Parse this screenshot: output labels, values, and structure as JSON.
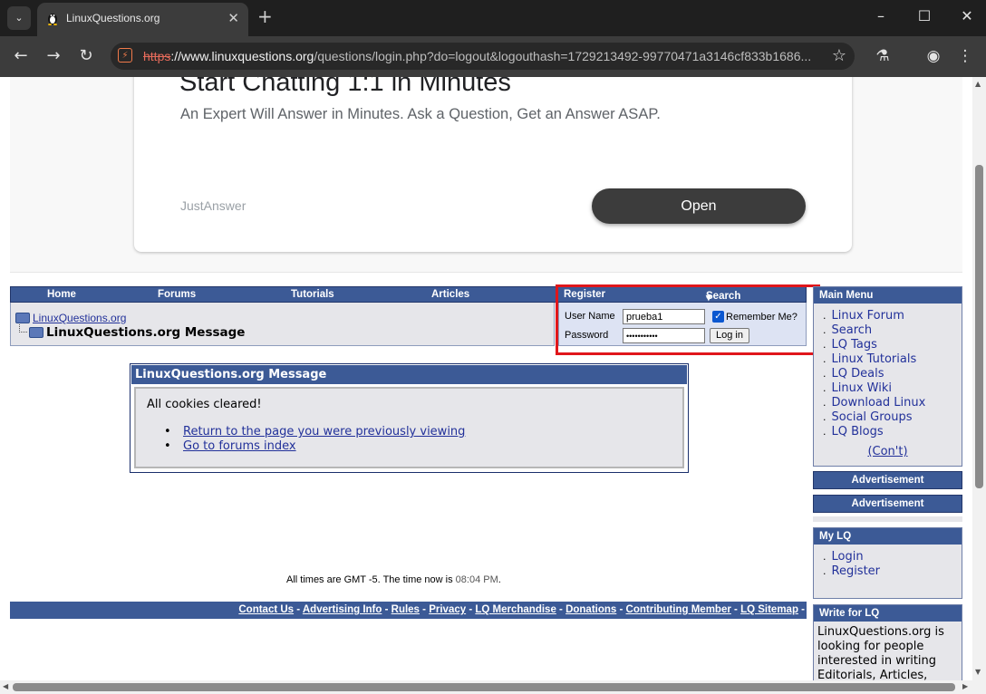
{
  "browser": {
    "tab_title": "LinuxQuestions.org",
    "tab_close": "✕",
    "new_tab": "+",
    "menu_icon": "chevron-down-icon",
    "url_scheme": "https",
    "url_host": "://www.linuxquestions.org",
    "url_path": "/questions/login.php?do=logout&logouthash=1729213492-99770471a3146cf833b1686...",
    "window_controls": [
      "–",
      "☐",
      "✕"
    ]
  },
  "ad": {
    "headline": "Start Chatting 1:1 in Minutes",
    "subline": "An Expert Will Answer in Minutes. Ask a Question, Get an Answer ASAP.",
    "brand": "JustAnswer",
    "open_label": "Open"
  },
  "nav": {
    "items": [
      "Home",
      "Forums",
      "Tutorials",
      "Articles"
    ],
    "register": "Register",
    "search": "Search"
  },
  "breadcrumb": {
    "root": "LinuxQuestions.org",
    "current": "LinuxQuestions.org Message"
  },
  "login": {
    "username_label": "User Name",
    "username_value": "prueba1",
    "remember_label": "Remember Me?",
    "remember_checked": true,
    "password_label": "Password",
    "password_value": "•••••••••••",
    "login_button": "Log in"
  },
  "message": {
    "header": "LinuxQuestions.org Message",
    "text": "All cookies cleared!",
    "links": [
      "Return to the page you were previously viewing",
      "Go to forums index"
    ]
  },
  "times": {
    "prefix": "All times are GMT -5. The time now is",
    "now": "08:04 PM",
    "suffix": "."
  },
  "footer": {
    "links": [
      "Contact Us",
      "Advertising Info",
      "Rules",
      "Privacy",
      "LQ Merchandise",
      "Donations",
      "Contributing Member",
      "LQ Sitemap"
    ]
  },
  "sidebar": {
    "main_menu_title": "Main Menu",
    "main_menu_items": [
      "Linux Forum",
      "Search",
      "LQ Tags",
      "Linux Tutorials",
      "LQ Deals",
      "Linux Wiki",
      "Download Linux",
      "Social Groups",
      "LQ Blogs"
    ],
    "main_menu_more": "(Con't)",
    "advertisement_1": "Advertisement",
    "advertisement_2": "Advertisement",
    "my_lq_title": "My LQ",
    "my_lq_items": [
      "Login",
      "Register"
    ],
    "write_title": "Write for LQ",
    "write_text": "LinuxQuestions.org is looking for people interested in writing Editorials, Articles,"
  },
  "colors": {
    "lq_blue": "#3c5a96",
    "link": "#22319a",
    "highlight": "#e0161b"
  }
}
